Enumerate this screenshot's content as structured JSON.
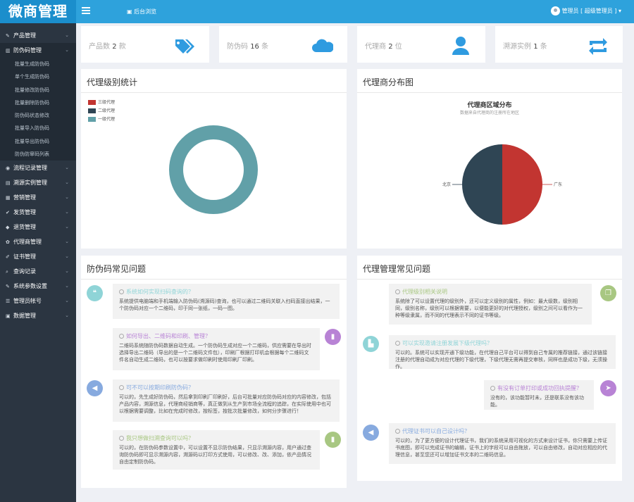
{
  "app": {
    "logo": "微商管理",
    "breadcrumb": "后台浏览",
    "user": "管理员 [ 超级管理员 ] ▾"
  },
  "sidebar": {
    "items": [
      {
        "label": "产品管理",
        "icon": "product-icon",
        "open": false,
        "children": []
      },
      {
        "label": "防伪码管理",
        "icon": "barcode-icon",
        "open": true,
        "children": [
          "批量生成防伪码",
          "单个生成防伪码",
          "批量修改防伪码",
          "批量删除防伪码",
          "防伪码状态修改",
          "批量导入防伪码",
          "批量导出防伪码",
          "防伪防窜码列表"
        ]
      },
      {
        "label": "流程记录管理",
        "icon": "flow-icon",
        "open": false,
        "children": []
      },
      {
        "label": "溯源实例管理",
        "icon": "trace-icon",
        "open": false,
        "children": []
      },
      {
        "label": "营销管理",
        "icon": "marketing-icon",
        "open": false,
        "children": []
      },
      {
        "label": "发货管理",
        "icon": "shipping-icon",
        "open": false,
        "children": []
      },
      {
        "label": "退货管理",
        "icon": "return-icon",
        "open": false,
        "children": []
      },
      {
        "label": "代理商管理",
        "icon": "agent-icon",
        "open": false,
        "children": []
      },
      {
        "label": "证书管理",
        "icon": "certificate-icon",
        "open": false,
        "children": []
      },
      {
        "label": "查询记录",
        "icon": "search-record-icon",
        "open": false,
        "children": []
      },
      {
        "label": "系统参数设置",
        "icon": "wrench-icon",
        "open": false,
        "children": []
      },
      {
        "label": "管理员帐号",
        "icon": "admin-icon",
        "open": false,
        "children": []
      },
      {
        "label": "数据管理",
        "icon": "data-icon",
        "open": false,
        "children": []
      }
    ]
  },
  "stats": [
    {
      "label": "产品数",
      "value": "2",
      "unit": "款",
      "icon": "tags-icon",
      "color": "#2f9be0"
    },
    {
      "label": "防伪码",
      "value": "16",
      "unit": "条",
      "icon": "cloud-icon",
      "color": "#2f9be0"
    },
    {
      "label": "代理商",
      "value": "2",
      "unit": "位",
      "icon": "user-icon",
      "color": "#2f9be0"
    },
    {
      "label": "溯源实例",
      "value": "1",
      "unit": "条",
      "icon": "retweet-icon",
      "color": "#2f9be0"
    }
  ],
  "level_panel": {
    "title": "代理级别统计"
  },
  "dist_panel": {
    "title": "代理商分布图"
  },
  "chart_data": [
    {
      "type": "pie",
      "title": "代理级别统计",
      "legend_position": "top-left",
      "series": [
        {
          "name": "三级代理",
          "value": 0,
          "color": "#c23531"
        },
        {
          "name": "二级代理",
          "value": 0,
          "color": "#2f4554"
        },
        {
          "name": "一级代理",
          "value": 2,
          "color": "#61a0a8"
        }
      ]
    },
    {
      "type": "pie",
      "title": "代理商区域分布",
      "subtitle": "数据来自代理商的注册所在地区",
      "series": [
        {
          "name": "广东",
          "value": 1,
          "color": "#c23531"
        },
        {
          "name": "北京",
          "value": 1,
          "color": "#2f4554"
        }
      ]
    }
  ],
  "faq_left": {
    "title": "防伪码常见问题",
    "items": [
      {
        "q": "系统如何实现扫码查询的？",
        "a": "系统提供电脑端和手机端输入防伪码(溯源码)查询，也可以通过二维码关联入扫码直接出结果，一个防伪码对应一个二维码，印于同一张纸，一码一图。",
        "color": "#8fd4d7",
        "icon": "comment-icon"
      },
      {
        "q": "如何导出、二维码和印刷、管理？",
        "a": "二维码系统随防伪码数据自动生成。一个防伪码生成对应一个二维码，供应需要在导出时选择导出二维码（导出的是一个二维码文件包），印刷厂根据打印机会根据每个二维码文件名自动生成二维码，也可以按要求做印刷时使用印刷厂印刷。",
        "color": "#b883d5",
        "icon": "book-icon"
      },
      {
        "q": "可不可以按期印刷防伪码？",
        "a": "可以的，先生成好防伪码，然后拿到印刷厂印刷好，后台可批量对应防伪码对应的内容修改，包括产品内容，溯源信息，代理商经销商等，真正做到从生产到市场全流程的追踪，在实际使用中也可以根据需要调整，比如在完成时修改，按标签，按批次批量修改，如何分步骤进行！",
        "color": "#87aadf",
        "icon": "bullhorn-icon"
      },
      {
        "q": "我只想做扫溯查询可以吗？",
        "a": "可以的，在防伪码参数设置中，可以设置不显示防伪结果，只显示溯源内容，用户通过查询防伪码即可显示溯源内容，溯源码以打印方式使用，可以修改、改、添加，依产品情况自由定制防伪码。",
        "color": "#a8c782",
        "icon": "book-icon"
      }
    ]
  },
  "faq_right": {
    "title": "代理管理常见问题",
    "items": [
      {
        "q": "代理级别相关说明",
        "a": "系统除了可以设置代理的级别外，还可以定义级别的属性，例如：最大级数，级别相同，级别名称，级别可以根据需要，以便能更好的对代理授权，级别之间可以看作为一种等级隶属，而不同的代理表示不同的证书等级。",
        "color": "#a8c782",
        "icon": "copy-icon"
      },
      {
        "q": "可以实现邀请注册发展下级代理吗？",
        "a": "可以的。系统可以实现开通下级功能，在代理自己平台可以得到自己专属的推荐链接，通过该链接注册的代理自动成为对应代理的下级代理，下级代理无需再提交审核，同样也是成功下级，无须操作。",
        "color": "#8fd4d7",
        "icon": "cart-icon"
      },
      {
        "q": "有没有订单打印或成功回执提醒？",
        "a": "没有的，该功能暂时未，还是联系没有该功能。",
        "color": "#b883d5",
        "icon": "rocket-icon"
      },
      {
        "q": "代理证书可以自己设计吗？",
        "a": "可以的，为了更方便的设计代理证书，我们的系统采用可视化的方式来设计证书，你只需要上传证书底图，即可以完成证书的编辑，证书上的字段可以自由拖放，可以自由修改，自动对应相应的代理信息，甚至您还可以增加证书文本的二维码信息。",
        "color": "#87aadf",
        "icon": "bullhorn-icon"
      }
    ]
  }
}
